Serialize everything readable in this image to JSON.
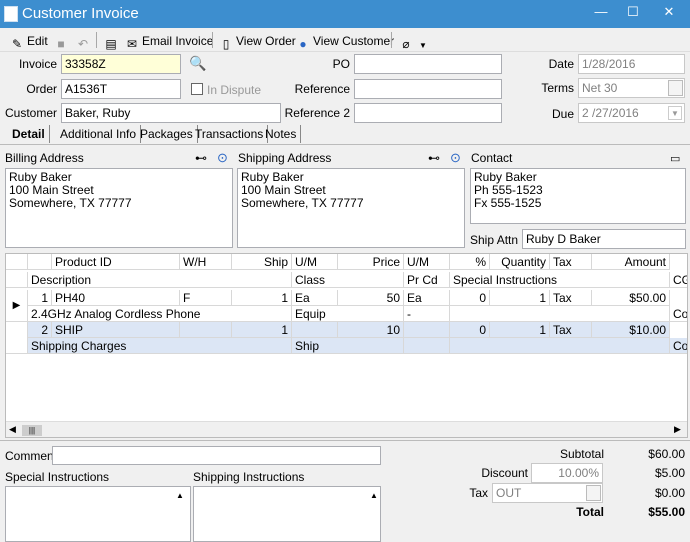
{
  "window": {
    "title": "Customer Invoice"
  },
  "toolbar": {
    "edit": "Edit",
    "email_invoice": "Email Invoice",
    "view_order": "View Order",
    "view_customer": "View Customer"
  },
  "header": {
    "invoice_label": "Invoice",
    "invoice_value": "33358Z",
    "order_label": "Order",
    "order_value": "A1536T",
    "customer_label": "Customer",
    "customer_value": "Baker, Ruby",
    "in_dispute": "In Dispute",
    "po_label": "PO",
    "po_value": "",
    "reference_label": "Reference",
    "reference_value": "",
    "reference2_label": "Reference 2",
    "reference2_value": "",
    "date_label": "Date",
    "date_value": "1/28/2016",
    "terms_label": "Terms",
    "terms_value": "Net 30",
    "due_label": "Due",
    "due_value": "2 /27/2016"
  },
  "tabs": [
    "Detail",
    "Additional Info",
    "Packages",
    "Transactions",
    "Notes"
  ],
  "billing": {
    "label": "Billing Address",
    "text": "Ruby Baker\n100 Main Street\nSomewhere, TX 77777"
  },
  "shipping": {
    "label": "Shipping Address",
    "text": "Ruby Baker\n100 Main Street\nSomewhere, TX 77777"
  },
  "contact": {
    "label": "Contact",
    "text": "Ruby Baker\nPh 555-1523\nFx 555-1525",
    "ship_attn_label": "Ship Attn",
    "ship_attn_value": "Ruby D Baker"
  },
  "grid": {
    "headers1": [
      "Product ID",
      "W/H",
      "Ship",
      "U/M",
      "Price",
      "U/M",
      "%",
      "Quantity",
      "Tax",
      "Amount"
    ],
    "headers2": [
      "Description",
      "Class",
      "Pr Cd",
      "Special Instructions",
      "CG"
    ],
    "rows": [
      {
        "num": "1",
        "product": "PH40",
        "wh": "F",
        "ship": "1",
        "um": "Ea",
        "price": "50",
        "um2": "Ea",
        "pct": "0",
        "qty": "1",
        "tax": "Tax",
        "amount": "$50.00",
        "desc": "2.4GHz Analog Cordless Phone",
        "class": "Equip",
        "prcd": "-",
        "co": "Co"
      },
      {
        "num": "2",
        "product": "SHIP",
        "wh": "",
        "ship": "1",
        "um": "",
        "price": "10",
        "um2": "",
        "pct": "0",
        "qty": "1",
        "tax": "Tax",
        "amount": "$10.00",
        "desc": "Shipping Charges",
        "class": "Ship",
        "prcd": "",
        "co": "Co"
      }
    ]
  },
  "bottom": {
    "comment_label": "Comment",
    "special_label": "Special Instructions",
    "shipping_label": "Shipping Instructions",
    "subtotal_label": "Subtotal",
    "subtotal": "$60.00",
    "discount_label": "Discount",
    "discount_pct": "10.00%",
    "discount": "$5.00",
    "tax_label": "Tax",
    "tax_code": "OUT",
    "tax": "$0.00",
    "total_label": "Total",
    "total": "$55.00"
  }
}
